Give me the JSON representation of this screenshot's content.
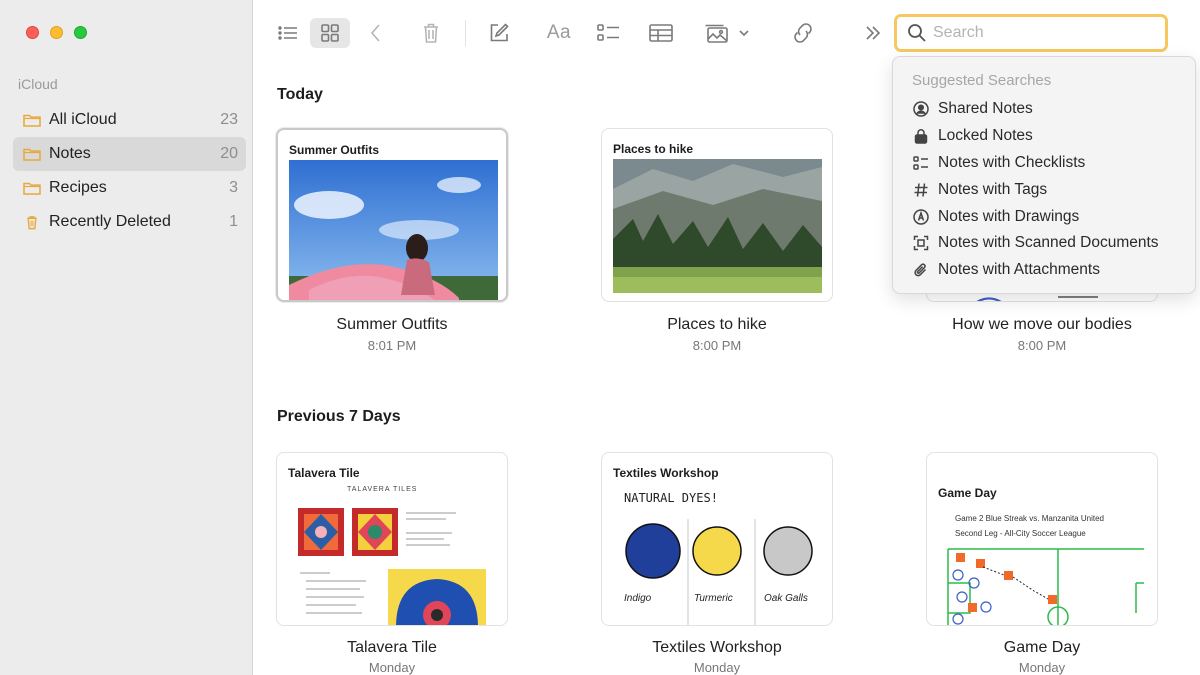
{
  "sidebar": {
    "section": "iCloud",
    "items": [
      {
        "label": "All iCloud",
        "count": "23",
        "icon": "folder-icon"
      },
      {
        "label": "Notes",
        "count": "20",
        "icon": "folder-icon",
        "active": true
      },
      {
        "label": "Recipes",
        "count": "3",
        "icon": "folder-icon"
      },
      {
        "label": "Recently Deleted",
        "count": "1",
        "icon": "trash-icon"
      }
    ]
  },
  "toolbar": {
    "format_label": "Aa",
    "search_placeholder": "Search"
  },
  "suggestions": {
    "header": "Suggested Searches",
    "items": [
      {
        "label": "Shared Notes",
        "icon": "person-circle-icon"
      },
      {
        "label": "Locked Notes",
        "icon": "lock-icon"
      },
      {
        "label": "Notes with Checklists",
        "icon": "checklist-icon"
      },
      {
        "label": "Notes with Tags",
        "icon": "hashtag-icon"
      },
      {
        "label": "Notes with Drawings",
        "icon": "pencil-circle-icon"
      },
      {
        "label": "Notes with Scanned Documents",
        "icon": "scan-icon"
      },
      {
        "label": "Notes with Attachments",
        "icon": "paperclip-icon"
      }
    ]
  },
  "sections": {
    "today": {
      "title": "Today",
      "notes": [
        {
          "title": "Summer Outfits",
          "name": "Summer Outfits",
          "time": "8:01 PM"
        },
        {
          "title": "Places to hike",
          "name": "Places to hike",
          "time": "8:00 PM"
        },
        {
          "title": "",
          "name": "How we move our bodies",
          "time": "8:00 PM"
        }
      ]
    },
    "previous": {
      "title": "Previous 7 Days",
      "notes": [
        {
          "title": "Talavera Tile",
          "name": "Talavera Tile",
          "time": "Monday"
        },
        {
          "title": "Textiles Workshop",
          "name": "Textiles Workshop",
          "time": "Monday"
        },
        {
          "title": "Game Day",
          "name": "Game Day",
          "time": "Monday"
        }
      ]
    }
  },
  "thumbnails": {
    "talavera_heading": "TALAVERA TILES",
    "textiles_heading": "NATURAL DYES!",
    "dyes": [
      "Indigo",
      "Turmeric",
      "Oak Galls"
    ],
    "game_line1": "Game 2 Blue Streak vs. Manzanita United",
    "game_line2": "Second Leg - All-City Soccer League"
  },
  "colors": {
    "accent_folder": "#e8a93a",
    "search_focus": "#f6c85f"
  }
}
